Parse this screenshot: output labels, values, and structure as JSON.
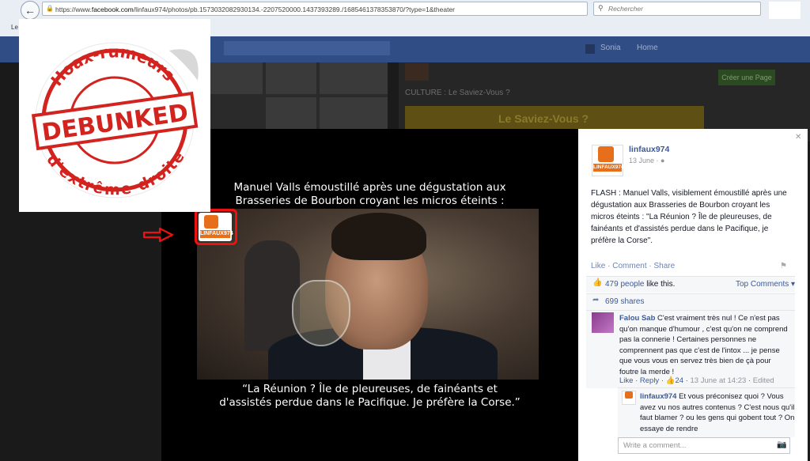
{
  "browser": {
    "url": "https://www.facebook.com/linfaux974/photos/pb.1573032082930134.-2207520000.1437393289./1685461378353870/?type=1&theater",
    "url_domain": "facebook.com",
    "url_prefix": "https://www.",
    "url_suffix": "/linfaux974/photos/pb.1573032082930134.-2207520000.1437393289./1685461378353870/?type=1&theater",
    "search_placeholder": "Rechercher",
    "bookmark_fragment": "Le"
  },
  "background_page": {
    "culture_text": "CULTURE : Le Saviez-Vous ?",
    "banner_text": "Le Saviez-Vous ?",
    "create_button": "Créer une Page",
    "header_home": "Home",
    "header_name": "Sonia"
  },
  "photo": {
    "headline_line1": "Manuel Valls émoustillé après une dégustation aux",
    "headline_line2": "Brasseries de Bourbon croyant les micros éteints :",
    "quote_line1": "“La Réunion ? Île de pleureuses, de fainéants et",
    "quote_line2": "d'assistés perdue dans le Pacifique. Je préfère la Corse.”",
    "watermark_text": "LINFAUX974"
  },
  "stamp": {
    "top_text": "Hoax-rumeurs",
    "center_text": "DEBUNKED",
    "bottom_text": "d'extrême-droite",
    "color": "#d3231f"
  },
  "post": {
    "page_name": "linfaux974",
    "logo_text": "LINFAUX974",
    "date": "13 June",
    "text": "FLASH : Manuel Valls, visiblement émoustillé après une dégustation aux Brasseries de Bourbon croyant les micros éteints : \"La Réunion ? Île de pleureuses, de fainéants et d'assistés perdue dans le Pacifique, je préfère la Corse\".",
    "actions": {
      "like": "Like",
      "comment": "Comment",
      "share": "Share"
    },
    "likes_count": "479 people",
    "likes_suffix": "like this.",
    "top_comments": "Top Comments",
    "shares": "699 shares",
    "comments": [
      {
        "author": "Falou Sab",
        "text": "C'est vraiment très nul ! Ce n'est pas qu'on manque d'humour , c'est qu'on ne comprend pas la connerie ! Certaines personnes ne comprennent pas que c'est de l'intox ... je pense que vous vous en servez très bien de çà pour foutre la merde !",
        "like": "Like",
        "reply": "Reply",
        "likes": "24",
        "timestamp": "13 June at 14:23",
        "edited": "Edited"
      }
    ],
    "reply": {
      "author": "linfaux974",
      "text": "Et vous préconisez quoi ? Vous avez vu nos autres contenus ? C'est nous qu'il faut blamer ? ou les gens qui gobent tout ? On essaye de rendre"
    },
    "write_placeholder": "Write a comment..."
  }
}
